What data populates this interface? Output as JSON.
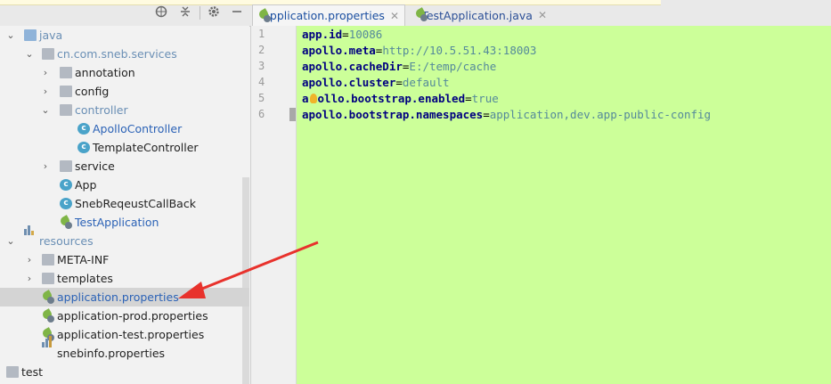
{
  "tabs": [
    {
      "label": "application.properties",
      "active": true
    },
    {
      "label": "TestApplication.java",
      "active": false
    }
  ],
  "toolbar": {
    "icons": [
      "target-icon",
      "collapse-icon",
      "gear-icon",
      "minimize-icon"
    ]
  },
  "tree": [
    {
      "label": "java",
      "depth": 0,
      "arrow": "expanded",
      "icon": "folder-src"
    },
    {
      "label": "cn.com.sneb.services",
      "depth": 1,
      "arrow": "expanded",
      "icon": "package"
    },
    {
      "label": "annotation",
      "depth": 2,
      "arrow": "collapsed",
      "icon": "package"
    },
    {
      "label": "config",
      "depth": 2,
      "arrow": "collapsed",
      "icon": "package"
    },
    {
      "label": "controller",
      "depth": 2,
      "arrow": "expanded",
      "icon": "package"
    },
    {
      "label": "ApolloController",
      "depth": 3,
      "arrow": "none",
      "icon": "class"
    },
    {
      "label": "TemplateController",
      "depth": 3,
      "arrow": "none",
      "icon": "class"
    },
    {
      "label": "service",
      "depth": 2,
      "arrow": "collapsed",
      "icon": "package"
    },
    {
      "label": "App",
      "depth": 2,
      "arrow": "none",
      "icon": "class-run"
    },
    {
      "label": "SnebReqeustCallBack",
      "depth": 2,
      "arrow": "none",
      "icon": "class"
    },
    {
      "label": "TestApplication",
      "depth": 2,
      "arrow": "none",
      "icon": "spring-class"
    },
    {
      "label": "resources",
      "depth": 0,
      "arrow": "expanded",
      "icon": "folder-res"
    },
    {
      "label": "META-INF",
      "depth": 1,
      "arrow": "collapsed",
      "icon": "folder"
    },
    {
      "label": "templates",
      "depth": 1,
      "arrow": "collapsed",
      "icon": "folder"
    },
    {
      "label": "application.properties",
      "depth": 1,
      "arrow": "none",
      "icon": "spring-props"
    },
    {
      "label": "application-prod.properties",
      "depth": 1,
      "arrow": "none",
      "icon": "spring-props"
    },
    {
      "label": "application-test.properties",
      "depth": 1,
      "arrow": "none",
      "icon": "spring-props"
    },
    {
      "label": "snebinfo.properties",
      "depth": 1,
      "arrow": "none",
      "icon": "props"
    },
    {
      "label": "test",
      "depth": -1,
      "arrow": "none",
      "icon": "folder"
    }
  ],
  "editor": {
    "lines": [
      {
        "num": "1",
        "key": "app.id",
        "eq": "=",
        "value": "10086"
      },
      {
        "num": "2",
        "key": "apollo.meta",
        "eq": "=",
        "value": "http://10.5.51.43:18003"
      },
      {
        "num": "3",
        "key": "apollo.cacheDir",
        "eq": "=",
        "value": "E:/temp/cache"
      },
      {
        "num": "4",
        "key": "apollo.cluster",
        "eq": "=",
        "value": "default"
      },
      {
        "num": "5",
        "key_a": "a",
        "key_b": "ollo.bootstrap.enabled",
        "eq": "=",
        "value": "true"
      },
      {
        "num": "6",
        "key": "apollo.bootstrap.namespaces",
        "eq": "=",
        "value": "application,dev.app-public-config"
      }
    ]
  },
  "colors": {
    "editor_bg": "#ccff99",
    "selection": "#d4d4d4",
    "arrow": "#e8322c"
  }
}
